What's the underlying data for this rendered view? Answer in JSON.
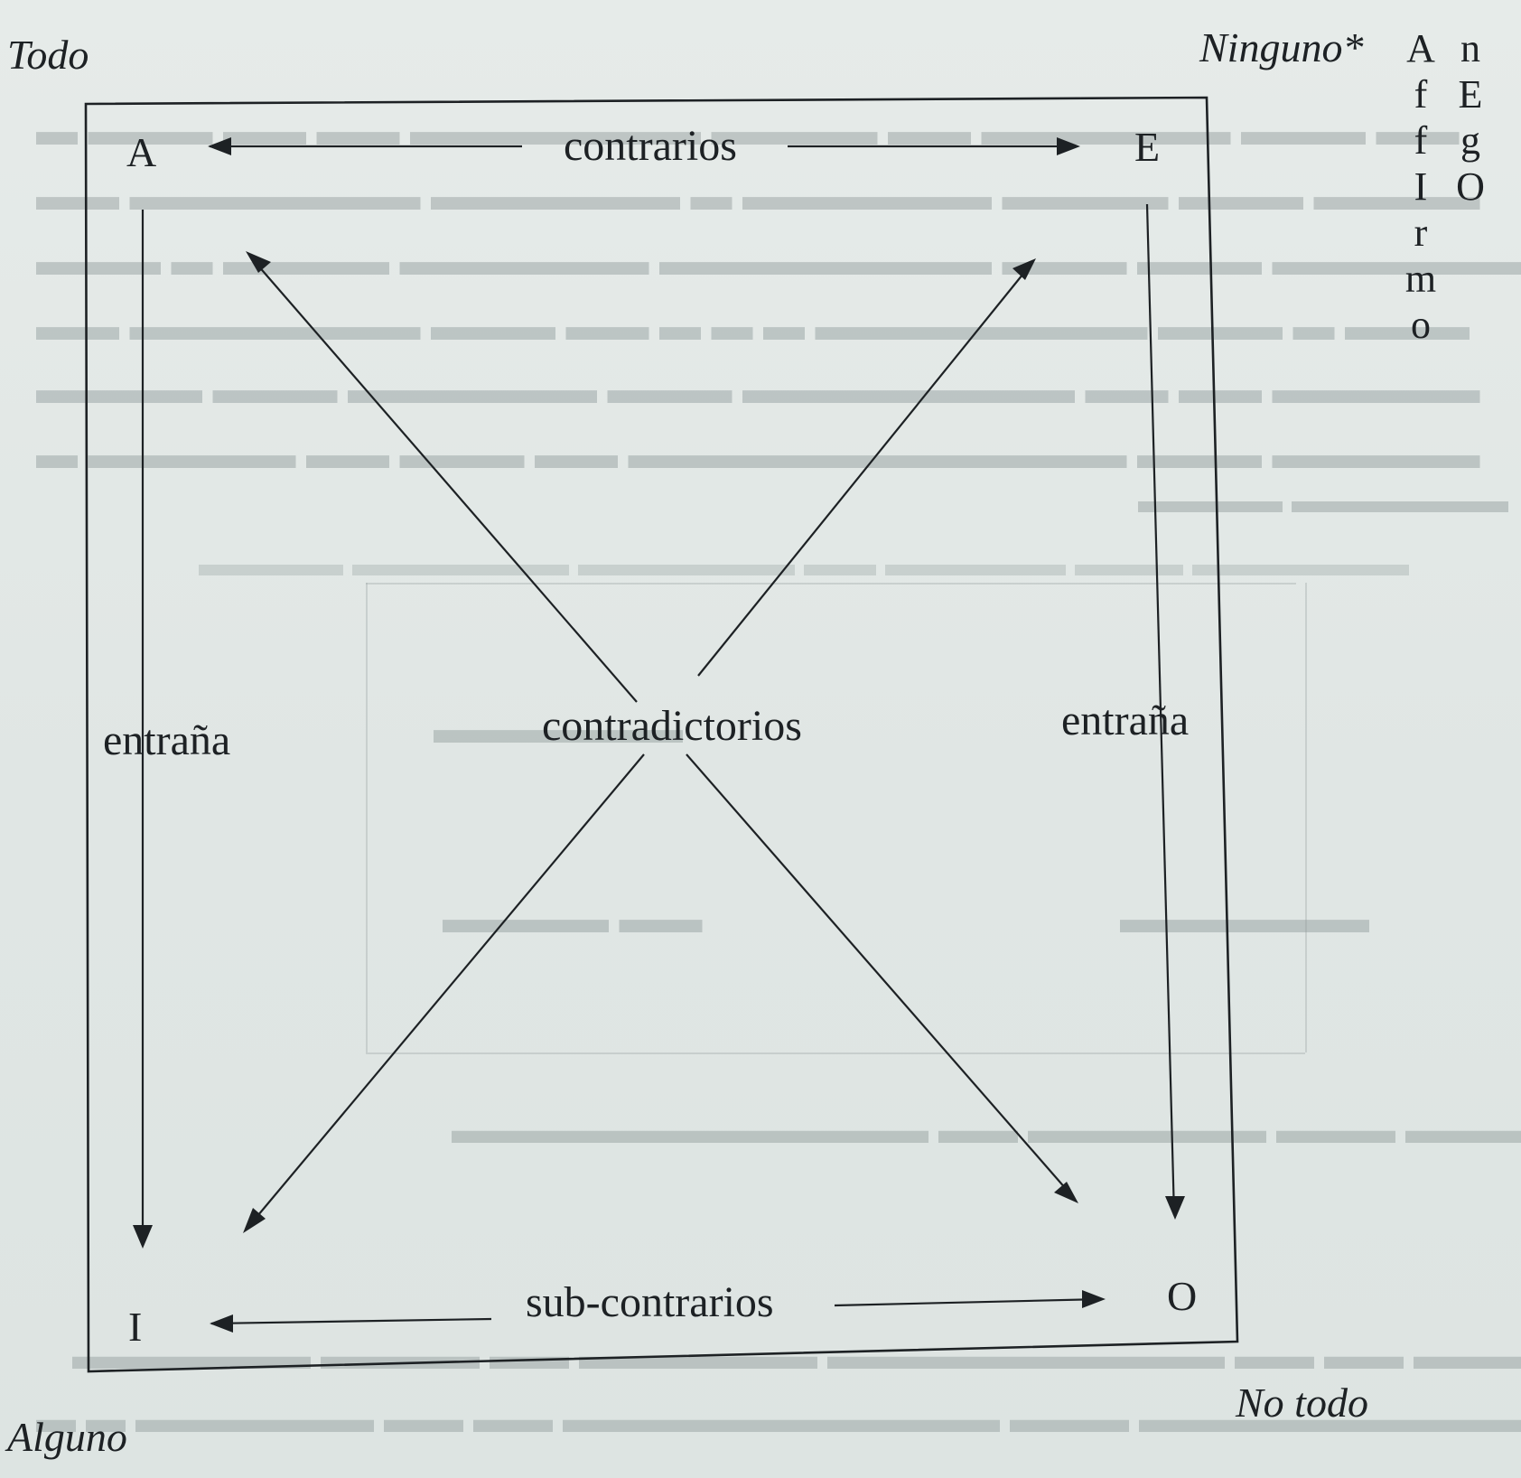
{
  "quantifiers": {
    "top_left": "Todo",
    "top_right": "Ninguno*",
    "bottom_left": "Alguno",
    "bottom_right": "No todo"
  },
  "vertices": {
    "a": "A",
    "e": "E",
    "i": "I",
    "o": "O"
  },
  "relations": {
    "top": "contrarios",
    "bottom": "sub-contrarios",
    "left": "entraña",
    "right": "entraña",
    "diagonal": "contradictorios"
  },
  "mnemonics": {
    "affirmo": [
      "A",
      "f",
      "f",
      "I",
      "r",
      "m",
      "o"
    ],
    "nego": [
      "n",
      "E",
      "g",
      "O"
    ]
  },
  "colors": {
    "paper": "#e3e9e7",
    "ink": "#1d2124",
    "ghost": "#8f9a9a"
  }
}
